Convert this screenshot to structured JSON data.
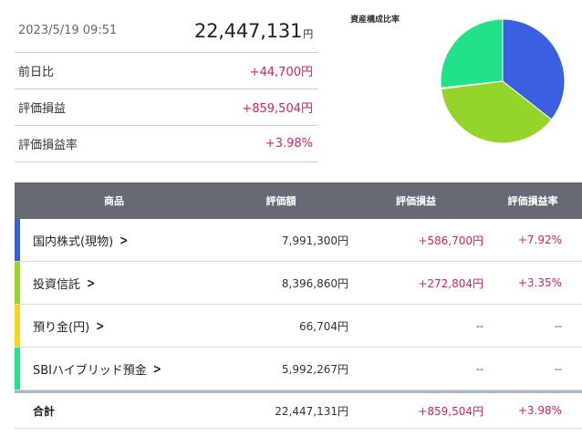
{
  "summary": {
    "date": "2023/5/19 09:51",
    "total_value": "22,447,131",
    "total_unit": "円",
    "rows": [
      {
        "label": "前日比",
        "value": "+44,700円"
      },
      {
        "label": "評価損益",
        "value": "+859,504円"
      },
      {
        "label": "評価損益率",
        "value": "+3.98%"
      }
    ]
  },
  "allocation_chart": {
    "title": "資産構成比率",
    "chart_data": {
      "type": "pie",
      "categories": [
        "国内株式(現物)",
        "投資信託",
        "預り金(円)",
        "SBIハイブリッド預金"
      ],
      "values": [
        7991300,
        8396860,
        66704,
        5992267
      ],
      "colors": [
        "#3a5fe0",
        "#95d42a",
        "#f4d41c",
        "#22e289"
      ]
    }
  },
  "table": {
    "headers": [
      "商品",
      "評価額",
      "評価損益",
      "評価損益率"
    ],
    "rows": [
      {
        "name": "国内株式(現物)",
        "value": "7,991,300円",
        "gain": "+586,700円",
        "rate": "+7.92%",
        "color": "#3a5fe0"
      },
      {
        "name": "投資信託",
        "value": "8,396,860円",
        "gain": "+272,804円",
        "rate": "+3.35%",
        "color": "#95d42a"
      },
      {
        "name": "預り金(円)",
        "value": "66,704円",
        "gain": "--",
        "rate": "--",
        "color": "#f4d41c"
      },
      {
        "name": "SBIハイブリッド預金",
        "value": "5,992,267円",
        "gain": "--",
        "rate": "--",
        "color": "#22e289"
      }
    ],
    "total": {
      "label": "合計",
      "value": "22,447,131円",
      "gain": "+859,504円",
      "rate": "+3.98%"
    },
    "chevron": "chevron-right-icon",
    "positive_color": "#d6245c"
  }
}
